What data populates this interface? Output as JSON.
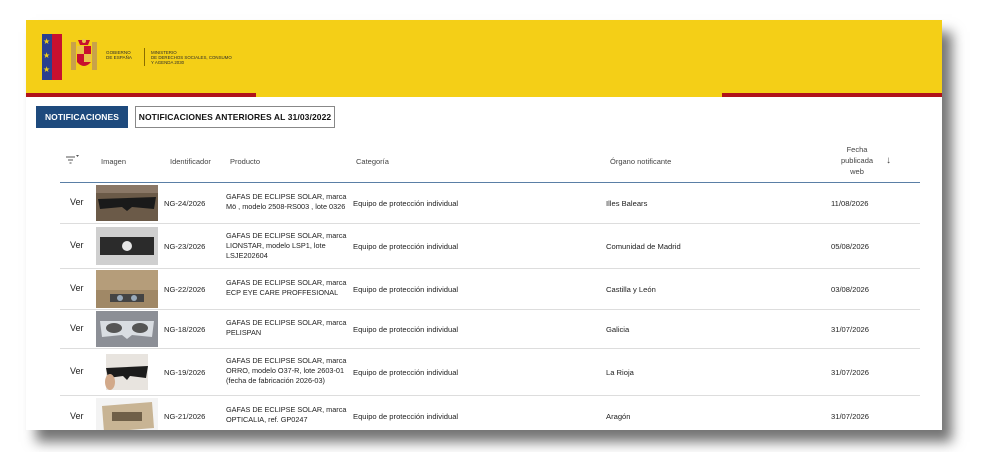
{
  "header": {
    "government_line1": "GOBIERNO",
    "government_line2": "DE ESPAÑA",
    "ministry_line1": "MINISTERIO",
    "ministry_line2": "DE DERECHOS SOCIALES, CONSUMO",
    "ministry_line3": "Y AGENDA 2030"
  },
  "tabs": [
    {
      "label": "NOTIFICACIONES",
      "active": true
    },
    {
      "label": "NOTIFICACIONES ANTERIORES AL 31/03/2022",
      "active": false
    }
  ],
  "table": {
    "columns": {
      "image": "Imagen",
      "id": "Identificador",
      "product": "Producto",
      "category": "Categoría",
      "organ": "Órgano notificante",
      "date_l1": "Fecha",
      "date_l2": "publicada",
      "date_l3": "web"
    },
    "rows": [
      {
        "action": "Ver",
        "id": "NG-24/2026",
        "product": "GAFAS DE ECLIPSE SOLAR, marca Mö , modelo 2508-RS003 , lote 0326",
        "category": "Equipo de protección individual",
        "organ": "Illes Balears",
        "date": "11/08/2026",
        "thumb_icon": "glasses-photo-dark"
      },
      {
        "action": "Ver",
        "id": "NG-23/2026",
        "product": "GAFAS DE ECLIPSE SOLAR, marca LIONSTAR, modelo LSP1, lote LSJE202604",
        "category": "Equipo de protección individual",
        "organ": "Comunidad de Madrid",
        "date": "05/08/2026",
        "thumb_icon": "glasses-photo-grey"
      },
      {
        "action": "Ver",
        "id": "NG-22/2026",
        "product": "GAFAS DE ECLIPSE SOLAR, marca ECP EYE CARE PROFFESIONAL",
        "category": "Equipo de protección individual",
        "organ": "Castilla y León",
        "date": "03/08/2026",
        "thumb_icon": "glasses-photo-cardboard"
      },
      {
        "action": "Ver",
        "id": "NG-18/2026",
        "product": "GAFAS DE ECLIPSE SOLAR, marca PELISPAN",
        "category": "Equipo de protección individual",
        "organ": "Galicia",
        "date": "31/07/2026",
        "thumb_icon": "glasses-photo-silver"
      },
      {
        "action": "Ver",
        "id": "NG-19/2026",
        "product": "GAFAS DE ECLIPSE SOLAR, marca ORRO, modelo O37-R, lote 2603-01 (fecha de fabricación 2026-03)",
        "category": "Equipo de protección individual",
        "organ": "La Rioja",
        "date": "31/07/2026",
        "thumb_icon": "glasses-photo-hand"
      },
      {
        "action": "Ver",
        "id": "NG-21/2026",
        "product": "GAFAS DE ECLIPSE SOLAR, marca OPTICALIA, ref. GP0247",
        "category": "Equipo de protección individual",
        "organ": "Aragón",
        "date": "31/07/2026",
        "thumb_icon": "glasses-photo-beige"
      }
    ]
  },
  "colors": {
    "header_yellow": "#f4cf17",
    "header_red": "#b0121a",
    "tab_active": "#1e4a7d",
    "table_rule": "#5a7fa6"
  }
}
